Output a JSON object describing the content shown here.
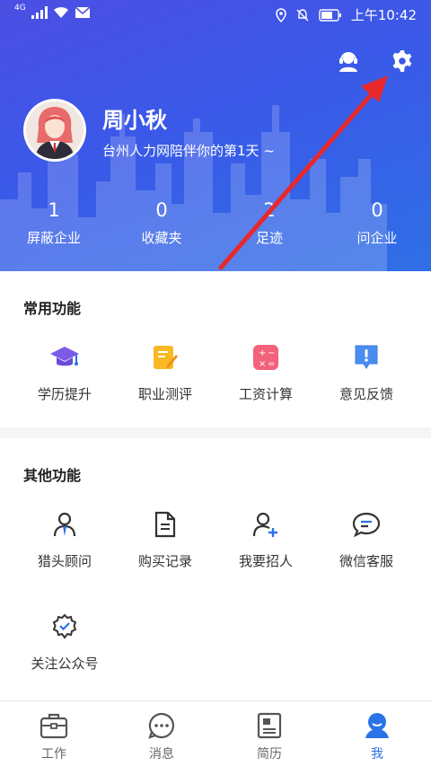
{
  "status_bar": {
    "network": "4G",
    "time": "上午10:42"
  },
  "header": {
    "user_name": "周小秋",
    "user_subtitle": "台州人力网陪伴你的第1天 ~",
    "icons": [
      "customer-service-icon",
      "gear-icon"
    ],
    "stats": [
      {
        "value": "1",
        "label": "屏蔽企业"
      },
      {
        "value": "0",
        "label": "收藏夹"
      },
      {
        "value": "2",
        "label": "足迹"
      },
      {
        "value": "0",
        "label": "问企业"
      }
    ]
  },
  "common_functions": {
    "title": "常用功能",
    "items": [
      {
        "label": "学历提升",
        "icon": "graduation-cap-icon"
      },
      {
        "label": "职业测评",
        "icon": "note-edit-icon"
      },
      {
        "label": "工资计算",
        "icon": "calculator-icon"
      },
      {
        "label": "意见反馈",
        "icon": "feedback-icon"
      }
    ]
  },
  "other_functions": {
    "title": "其他功能",
    "items": [
      {
        "label": "猎头顾问",
        "icon": "headhunter-icon"
      },
      {
        "label": "购买记录",
        "icon": "document-icon"
      },
      {
        "label": "我要招人",
        "icon": "add-user-icon"
      },
      {
        "label": "微信客服",
        "icon": "chat-bubble-icon"
      },
      {
        "label": "关注公众号",
        "icon": "verified-badge-icon"
      }
    ]
  },
  "bottom_nav": {
    "items": [
      {
        "label": "工作",
        "icon": "briefcase-icon"
      },
      {
        "label": "消息",
        "icon": "message-icon"
      },
      {
        "label": "简历",
        "icon": "resume-icon"
      },
      {
        "label": "我",
        "icon": "profile-icon"
      }
    ],
    "active": "我"
  },
  "colors": {
    "header_gradient_start": "#4c4fe3",
    "header_gradient_end": "#2f6fe6",
    "accent": "#2a72e8",
    "annotation_arrow": "#e8282b"
  }
}
